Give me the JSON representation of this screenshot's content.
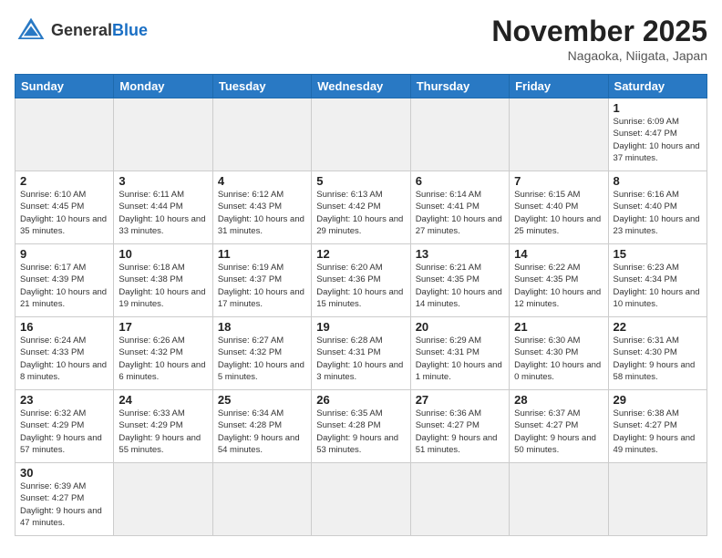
{
  "header": {
    "logo_general": "General",
    "logo_blue": "Blue",
    "month_year": "November 2025",
    "location": "Nagaoka, Niigata, Japan"
  },
  "weekdays": [
    "Sunday",
    "Monday",
    "Tuesday",
    "Wednesday",
    "Thursday",
    "Friday",
    "Saturday"
  ],
  "weeks": [
    [
      {
        "day": "",
        "empty": true
      },
      {
        "day": "",
        "empty": true
      },
      {
        "day": "",
        "empty": true
      },
      {
        "day": "",
        "empty": true
      },
      {
        "day": "",
        "empty": true
      },
      {
        "day": "",
        "empty": true
      },
      {
        "day": "1",
        "sunrise": "6:09 AM",
        "sunset": "4:47 PM",
        "daylight": "10 hours and 37 minutes."
      }
    ],
    [
      {
        "day": "2",
        "sunrise": "6:10 AM",
        "sunset": "4:45 PM",
        "daylight": "10 hours and 35 minutes."
      },
      {
        "day": "3",
        "sunrise": "6:11 AM",
        "sunset": "4:44 PM",
        "daylight": "10 hours and 33 minutes."
      },
      {
        "day": "4",
        "sunrise": "6:12 AM",
        "sunset": "4:43 PM",
        "daylight": "10 hours and 31 minutes."
      },
      {
        "day": "5",
        "sunrise": "6:13 AM",
        "sunset": "4:42 PM",
        "daylight": "10 hours and 29 minutes."
      },
      {
        "day": "6",
        "sunrise": "6:14 AM",
        "sunset": "4:41 PM",
        "daylight": "10 hours and 27 minutes."
      },
      {
        "day": "7",
        "sunrise": "6:15 AM",
        "sunset": "4:40 PM",
        "daylight": "10 hours and 25 minutes."
      },
      {
        "day": "8",
        "sunrise": "6:16 AM",
        "sunset": "4:40 PM",
        "daylight": "10 hours and 23 minutes."
      }
    ],
    [
      {
        "day": "9",
        "sunrise": "6:17 AM",
        "sunset": "4:39 PM",
        "daylight": "10 hours and 21 minutes."
      },
      {
        "day": "10",
        "sunrise": "6:18 AM",
        "sunset": "4:38 PM",
        "daylight": "10 hours and 19 minutes."
      },
      {
        "day": "11",
        "sunrise": "6:19 AM",
        "sunset": "4:37 PM",
        "daylight": "10 hours and 17 minutes."
      },
      {
        "day": "12",
        "sunrise": "6:20 AM",
        "sunset": "4:36 PM",
        "daylight": "10 hours and 15 minutes."
      },
      {
        "day": "13",
        "sunrise": "6:21 AM",
        "sunset": "4:35 PM",
        "daylight": "10 hours and 14 minutes."
      },
      {
        "day": "14",
        "sunrise": "6:22 AM",
        "sunset": "4:35 PM",
        "daylight": "10 hours and 12 minutes."
      },
      {
        "day": "15",
        "sunrise": "6:23 AM",
        "sunset": "4:34 PM",
        "daylight": "10 hours and 10 minutes."
      }
    ],
    [
      {
        "day": "16",
        "sunrise": "6:24 AM",
        "sunset": "4:33 PM",
        "daylight": "10 hours and 8 minutes."
      },
      {
        "day": "17",
        "sunrise": "6:26 AM",
        "sunset": "4:32 PM",
        "daylight": "10 hours and 6 minutes."
      },
      {
        "day": "18",
        "sunrise": "6:27 AM",
        "sunset": "4:32 PM",
        "daylight": "10 hours and 5 minutes."
      },
      {
        "day": "19",
        "sunrise": "6:28 AM",
        "sunset": "4:31 PM",
        "daylight": "10 hours and 3 minutes."
      },
      {
        "day": "20",
        "sunrise": "6:29 AM",
        "sunset": "4:31 PM",
        "daylight": "10 hours and 1 minute."
      },
      {
        "day": "21",
        "sunrise": "6:30 AM",
        "sunset": "4:30 PM",
        "daylight": "10 hours and 0 minutes."
      },
      {
        "day": "22",
        "sunrise": "6:31 AM",
        "sunset": "4:30 PM",
        "daylight": "9 hours and 58 minutes."
      }
    ],
    [
      {
        "day": "23",
        "sunrise": "6:32 AM",
        "sunset": "4:29 PM",
        "daylight": "9 hours and 57 minutes."
      },
      {
        "day": "24",
        "sunrise": "6:33 AM",
        "sunset": "4:29 PM",
        "daylight": "9 hours and 55 minutes."
      },
      {
        "day": "25",
        "sunrise": "6:34 AM",
        "sunset": "4:28 PM",
        "daylight": "9 hours and 54 minutes."
      },
      {
        "day": "26",
        "sunrise": "6:35 AM",
        "sunset": "4:28 PM",
        "daylight": "9 hours and 53 minutes."
      },
      {
        "day": "27",
        "sunrise": "6:36 AM",
        "sunset": "4:27 PM",
        "daylight": "9 hours and 51 minutes."
      },
      {
        "day": "28",
        "sunrise": "6:37 AM",
        "sunset": "4:27 PM",
        "daylight": "9 hours and 50 minutes."
      },
      {
        "day": "29",
        "sunrise": "6:38 AM",
        "sunset": "4:27 PM",
        "daylight": "9 hours and 49 minutes."
      }
    ],
    [
      {
        "day": "30",
        "sunrise": "6:39 AM",
        "sunset": "4:27 PM",
        "daylight": "9 hours and 47 minutes."
      },
      {
        "day": "",
        "empty": true
      },
      {
        "day": "",
        "empty": true
      },
      {
        "day": "",
        "empty": true
      },
      {
        "day": "",
        "empty": true
      },
      {
        "day": "",
        "empty": true
      },
      {
        "day": "",
        "empty": true
      }
    ]
  ],
  "labels": {
    "sunrise": "Sunrise:",
    "sunset": "Sunset:",
    "daylight": "Daylight:"
  }
}
